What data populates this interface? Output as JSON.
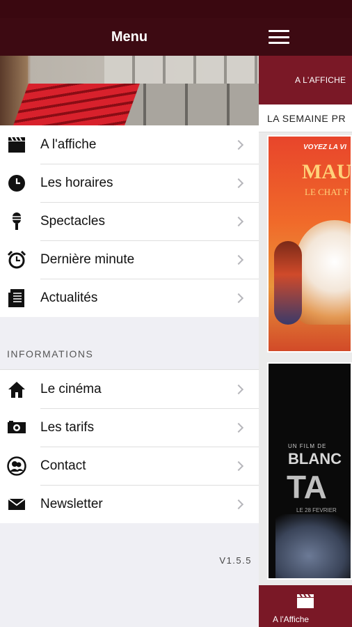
{
  "menu": {
    "title": "Menu",
    "items": [
      {
        "label": "A l'affiche",
        "icon": "clapperboard-icon"
      },
      {
        "label": "Les horaires",
        "icon": "clock-icon"
      },
      {
        "label": "Spectacles",
        "icon": "microphone-icon"
      },
      {
        "label": "Dernière minute",
        "icon": "alarm-clock-icon"
      },
      {
        "label": "Actualités",
        "icon": "newspaper-icon"
      }
    ],
    "info_heading": "INFORMATIONS",
    "info_items": [
      {
        "label": "Le cinéma",
        "icon": "home-icon"
      },
      {
        "label": "Les tarifs",
        "icon": "ticket-icon"
      },
      {
        "label": "Contact",
        "icon": "contacts-icon"
      },
      {
        "label": "Newsletter",
        "icon": "envelope-icon"
      }
    ],
    "version": "V1.5.5"
  },
  "main": {
    "tab_label": "A L'AFFICHE",
    "section_title": "LA SEMAINE PR",
    "posters": [
      {
        "tagline": "VOYEZ LA VI",
        "title": "MAUI",
        "subtitle": "LE CHAT F"
      },
      {
        "small": "UN FILM DE",
        "title": "BLANC",
        "big": "TA",
        "date": "LE 28 FEVRIER"
      }
    ],
    "bottom_tab_label": "A l'Affiche"
  },
  "colors": {
    "header": "#3d0a12",
    "accent": "#7a1826",
    "background": "#efeff4"
  }
}
